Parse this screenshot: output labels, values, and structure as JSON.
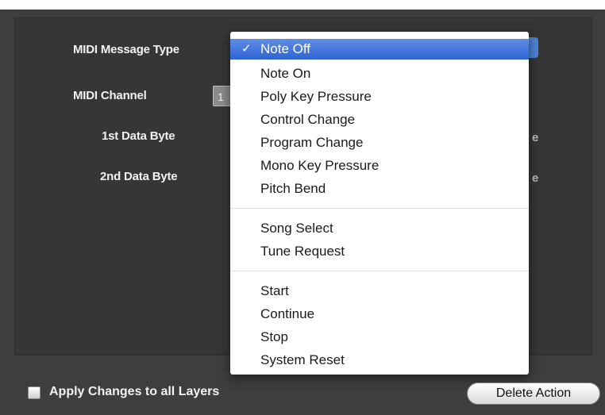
{
  "form": {
    "message_type_label": "MIDI Message Type",
    "channel_label": "MIDI Channel",
    "channel_value": "1",
    "data_byte1_label": "1st Data Byte",
    "data_byte2_label": "2nd Data Byte",
    "obscured_suffix_1": "e",
    "obscured_suffix_2": "e"
  },
  "menu": {
    "selected": "Note Off",
    "check_glyph": "✓",
    "groups": [
      [
        "Note Off",
        "Note On",
        "Poly Key Pressure",
        "Control Change",
        "Program Change",
        "Mono Key Pressure",
        "Pitch Bend"
      ],
      [
        "Song Select",
        "Tune Request"
      ],
      [
        "Start",
        "Continue",
        "Stop",
        "System Reset"
      ]
    ]
  },
  "footer": {
    "apply_all_label": "Apply Changes to all Layers",
    "apply_all_checked": false,
    "delete_label": "Delete Action"
  },
  "colors": {
    "panel": "#3e3e3e",
    "selection": "#3a6fd9",
    "menu_bg": "#ffffff"
  }
}
